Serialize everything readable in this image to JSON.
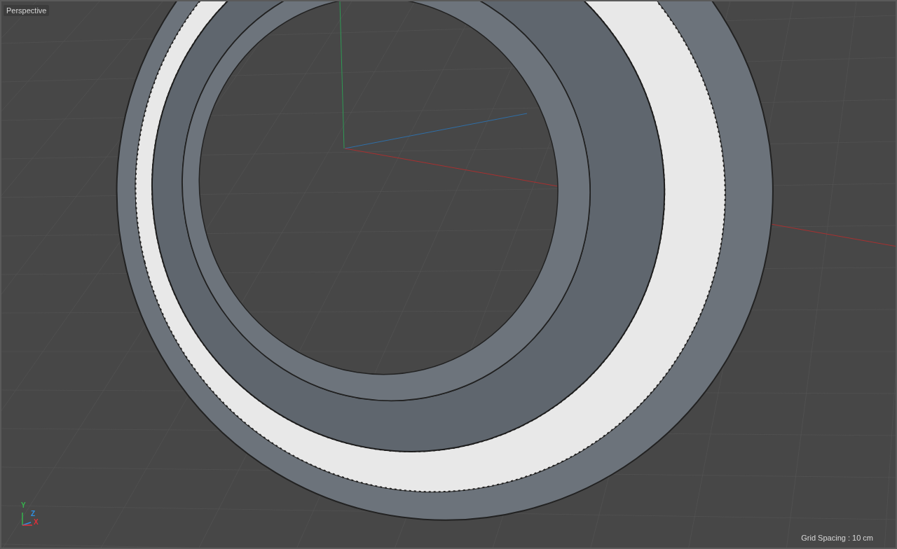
{
  "viewport": {
    "title": "Perspective",
    "grid_spacing": "Grid Spacing : 10 cm",
    "axes": [
      {
        "label": "Y",
        "color": "#35b54d"
      },
      {
        "label": "Z",
        "color": "#2f8fe0"
      },
      {
        "label": "X",
        "color": "#e0303a"
      }
    ]
  }
}
